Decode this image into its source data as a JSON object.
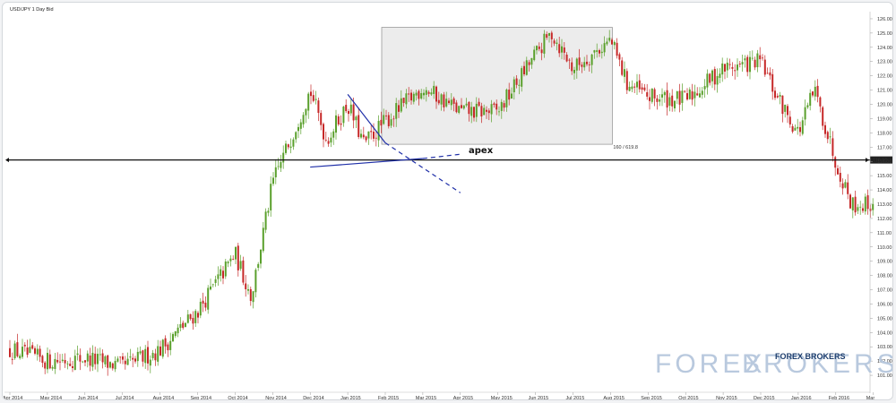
{
  "chart_data": {
    "type": "candlestick",
    "title": "USD/JPY 1 Day Bid",
    "ylim": [
      100,
      126.5
    ],
    "y_ticks": [
      "126.00",
      "125.00",
      "124.00",
      "123.00",
      "122.00",
      "121.00",
      "120.00",
      "119.00",
      "118.00",
      "117.00",
      "116.00",
      "115.00",
      "114.00",
      "113.00",
      "112.00",
      "111.00",
      "110.00",
      "109.00",
      "108.00",
      "107.00",
      "106.00",
      "105.00",
      "104.00",
      "103.00",
      "102.00",
      "101.00"
    ],
    "x_ticks": [
      "Apr 2014",
      "May 2014",
      "Jun 2014",
      "Jul 2014",
      "Aug 2014",
      "Sep 2014",
      "Oct 2014",
      "Nov 2014",
      "Dec 2014",
      "Jan 2015",
      "Feb 2015",
      "Mar 2015",
      "Apr 2015",
      "May 2015",
      "Jun 2015",
      "Jul 2015",
      "Aug 2015",
      "Sep 2015",
      "Oct 2015",
      "Nov 2015",
      "Dec 2015",
      "Jan 2016",
      "Feb 2016",
      "Mar"
    ],
    "x_years": [
      "2014",
      "2015",
      "2016"
    ],
    "current_price_label": "116.10",
    "range_box_label": "160 / 619.8",
    "annotation": "apex",
    "up_color": "#5aa02c",
    "down_color": "#c62828",
    "close_path": [
      [
        "Apr 2014",
        102.8
      ],
      [
        "May 2014",
        102.0
      ],
      [
        "Jun 2014",
        102.2
      ],
      [
        "Jul 2014",
        101.6
      ],
      [
        "Aug 2014",
        102.8
      ],
      [
        "Sep 2014",
        105.5
      ],
      [
        "Oct 2014",
        109.5
      ],
      [
        "Oct 2014",
        106.5
      ],
      [
        "Nov 2014",
        114.5
      ],
      [
        "Dec 2014",
        121.0
      ],
      [
        "Dec 2014",
        117.5
      ],
      [
        "Jan 2015",
        120.0
      ],
      [
        "Jan 2015",
        117.2
      ],
      [
        "Feb 2015",
        118.8
      ],
      [
        "Mar 2015",
        121.2
      ],
      [
        "Apr 2015",
        119.5
      ],
      [
        "May 2015",
        119.5
      ],
      [
        "Jun 2015",
        123.5
      ],
      [
        "Jun 2015",
        125.0
      ],
      [
        "Jul 2015",
        122.5
      ],
      [
        "Aug 2015",
        124.5
      ],
      [
        "Aug 2015",
        121.5
      ],
      [
        "Sep 2015",
        120.5
      ],
      [
        "Oct 2015",
        120.3
      ],
      [
        "Nov 2015",
        122.5
      ],
      [
        "Dec 2015",
        123.0
      ],
      [
        "Dec 2015",
        120.5
      ],
      [
        "Jan 2016",
        118.0
      ],
      [
        "Jan 2016",
        121.0
      ],
      [
        "Feb 2016",
        116.0
      ],
      [
        "Feb 2016",
        113.0
      ],
      [
        "Mar",
        113.0
      ]
    ],
    "horizontal_line": 116.1,
    "range_box": {
      "x_start": "Feb 2015",
      "x_end": "Aug 2015",
      "y_low": 117.2,
      "y_high": 125.4
    },
    "triangle": {
      "upper": [
        [
          "Jan 2015",
          120.7
        ],
        [
          "Feb 2015",
          117.3
        ]
      ],
      "upper_extension": [
        [
          "Feb 2015",
          117.3
        ],
        [
          "Apr 2015",
          113.8
        ]
      ],
      "lower": [
        [
          "Dec 2014",
          115.6
        ],
        [
          "Mar 2015",
          116.2
        ]
      ],
      "lower_extension": [
        [
          "Mar 2015",
          116.2
        ],
        [
          "Apr 2015",
          116.5
        ]
      ]
    }
  },
  "watermark": {
    "faded": "FOREX",
    "faded2": "BROKERS",
    "logo": "FOREX BROKERS"
  }
}
